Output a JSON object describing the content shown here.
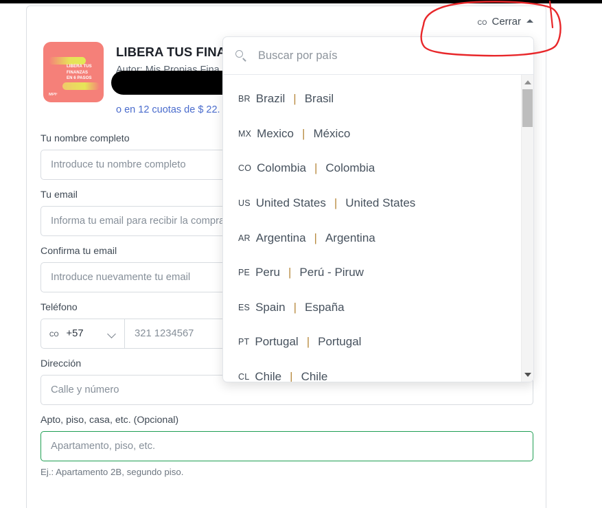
{
  "header": {
    "country_code": "co",
    "close_label": "Cerrar",
    "caret_icon": "chevron-up-icon"
  },
  "product": {
    "name": "LIBERA TUS FINA",
    "author": "Autor: Mis Propias Fina",
    "installments": "o en 12 cuotas de $ 22.",
    "price_redacted": true,
    "thumb": {
      "title_lines": [
        "LIBERA TUS",
        "FINANZAS",
        "EN 6 PASOS"
      ],
      "logo": "MPF",
      "bg_color": "#f58079",
      "accent_color": "#e2ea55"
    }
  },
  "form": {
    "fields": [
      {
        "label": "Tu nombre completo",
        "placeholder": "Introduce tu nombre completo",
        "value": "",
        "name": "full-name"
      },
      {
        "label": "Tu email",
        "placeholder": "Informa tu email para recibir la compra",
        "value": "",
        "name": "email"
      },
      {
        "label": "Confirma tu email",
        "placeholder": "Introduce nuevamente tu email",
        "value": "",
        "name": "email-confirm"
      }
    ],
    "phone": {
      "label": "Teléfono",
      "country_code": "co",
      "dial_code": "+57",
      "placeholder": "321 1234567",
      "value": "",
      "chevron_icon": "chevron-down-icon"
    },
    "address": {
      "label": "Dirección",
      "placeholder": "Calle y número",
      "value": ""
    },
    "apartment": {
      "label": "Apto, piso, casa, etc. (Opcional)",
      "placeholder": "Apartamento, piso, etc.",
      "value": "",
      "hint": "Ej.: Apartamento 2B, segundo piso.",
      "focused": true,
      "focus_color": "#1e9e52"
    }
  },
  "country_dropdown": {
    "search_placeholder": "Buscar por país",
    "search_value": "",
    "search_icon": "search-icon",
    "items": [
      {
        "code": "BR",
        "name_en": "Brazil",
        "name_local": "Brasil"
      },
      {
        "code": "MX",
        "name_en": "Mexico",
        "name_local": "México"
      },
      {
        "code": "CO",
        "name_en": "Colombia",
        "name_local": "Colombia"
      },
      {
        "code": "US",
        "name_en": "United States",
        "name_local": "United States"
      },
      {
        "code": "AR",
        "name_en": "Argentina",
        "name_local": "Argentina"
      },
      {
        "code": "PE",
        "name_en": "Peru",
        "name_local": "Perú - Piruw"
      },
      {
        "code": "ES",
        "name_en": "Spain",
        "name_local": "España"
      },
      {
        "code": "PT",
        "name_en": "Portugal",
        "name_local": "Portugal"
      },
      {
        "code": "CL",
        "name_en": "Chile",
        "name_local": "Chile"
      }
    ],
    "separator": "|",
    "scrollbar": {
      "up_icon": "scroll-up-arrow-icon",
      "down_icon": "scroll-down-arrow-icon"
    }
  },
  "annotation": {
    "color": "#e8272a",
    "shape": "hand-drawn-ellipse"
  }
}
